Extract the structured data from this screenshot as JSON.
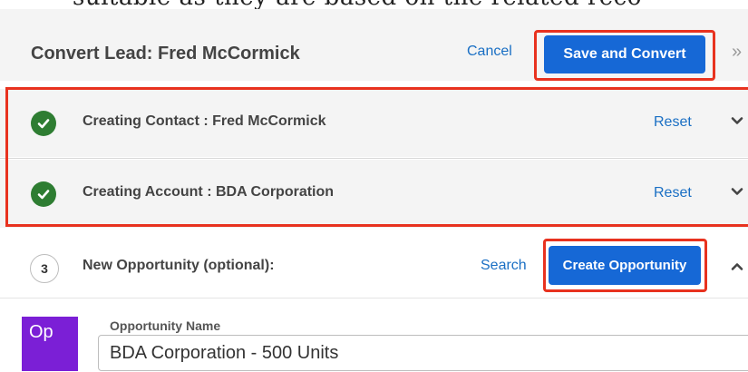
{
  "background_text": "suitable as they are based on the related reco",
  "header": {
    "title": "Convert Lead: Fred McCormick",
    "cancel_label": "Cancel",
    "save_label": "Save and Convert",
    "collapse_icon": "double-chevron-right-icon"
  },
  "steps": [
    {
      "label": "Creating Contact : Fred McCormick",
      "status_icon": "check-circle-icon",
      "reset_label": "Reset",
      "toggle_icon": "chevron-down-icon"
    },
    {
      "label": "Creating Account : BDA Corporation",
      "status_icon": "check-circle-icon",
      "reset_label": "Reset",
      "toggle_icon": "chevron-down-icon"
    },
    {
      "number": "3",
      "label": "New Opportunity (optional):",
      "search_label": "Search",
      "create_label": "Create Opportunity",
      "toggle_icon": "chevron-up-icon"
    }
  ],
  "form": {
    "module_badge": "Op",
    "field_label": "Opportunity Name",
    "field_value": "BDA Corporation - 500 Units"
  },
  "colors": {
    "primary_button": "#1668d6",
    "highlight_outline": "#e8321f",
    "success": "#2e7d32",
    "link": "#1a6fc4",
    "opportunity_module": "#7b1fd6"
  }
}
